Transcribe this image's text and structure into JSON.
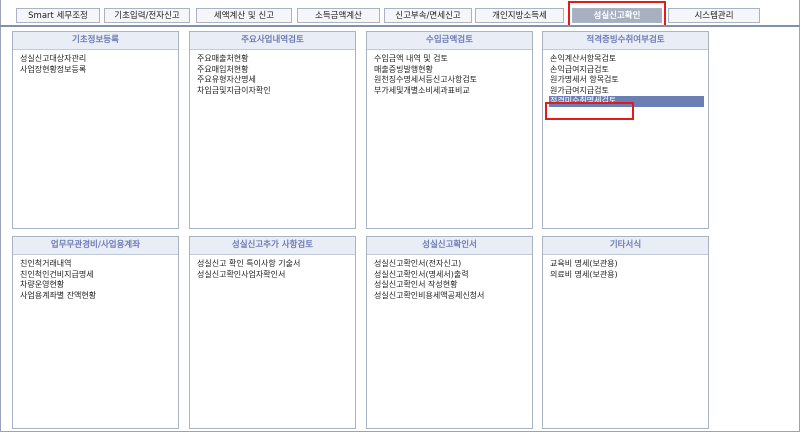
{
  "tabs": [
    {
      "label": "Smart 세무조정"
    },
    {
      "label": "기초입력/전자신고"
    },
    {
      "label": "세액계산 및 신고"
    },
    {
      "label": "소득금액계산"
    },
    {
      "label": "신고부속/면세신고"
    },
    {
      "label": "개인지방소득세"
    },
    {
      "label": "성실신고확인",
      "active": true
    },
    {
      "label": "시스템관리"
    }
  ],
  "panels": [
    {
      "title": "기초정보등록",
      "items": [
        "성실신고대상자관리",
        "사업장현황정보등록"
      ]
    },
    {
      "title": "주요사업내역검토",
      "items": [
        "주요매출처현황",
        "주요매입처현황",
        "주요유형자산명세",
        "차입금및지급이자확인"
      ]
    },
    {
      "title": "수입금액검토",
      "items": [
        "수입금액 내역 및 검토",
        "매출증빙발행현황",
        "원천징수명세서등신고사항검토",
        "부가세및개별소비세과표비교"
      ]
    },
    {
      "title": "적격증빙수취여부검토",
      "items": [
        "손익계산서항목검토",
        "손익급여지급검토",
        "원가명세서 항목검토",
        "원가급여지급검토",
        "적격미수취명세검토"
      ],
      "selected_index": 4
    },
    {
      "title": "업무무관경비/사업용계좌",
      "items": [
        "친인척거래내역",
        "친인척인건비지급명세",
        "차량운영현황",
        "사업용계좌별 잔액현황"
      ]
    },
    {
      "title": "성실신고추가 사항검토",
      "items": [
        "성실신고 확인 특이사항 기술서",
        "성실신고확인사업자확인서"
      ]
    },
    {
      "title": "성실신고확인서",
      "items": [
        "성실신고확인서(전자신고)",
        "성실신고확인서(명세서)출력",
        "성실신고확인서 작성현황",
        "성실신고확인비용세액공제신청서"
      ]
    },
    {
      "title": "기타서식",
      "items": [
        "교육비 명세(보관용)",
        "의료비 명세(보관용)"
      ]
    }
  ]
}
